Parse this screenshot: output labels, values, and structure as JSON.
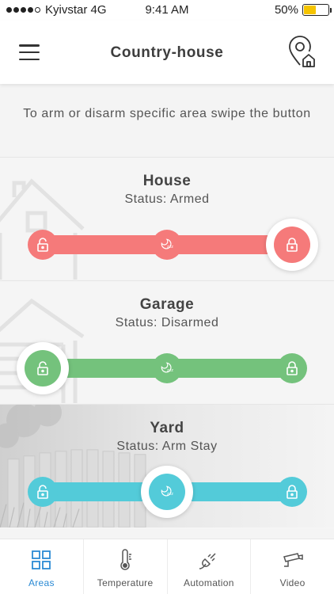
{
  "status_bar": {
    "carrier": "Kyivstar 4G",
    "time": "9:41 AM",
    "battery": "50%",
    "battery_level": 0.5
  },
  "header": {
    "title": "Country-house"
  },
  "instruction": "To arm or disarm specific area swipe the button",
  "areas": [
    {
      "name": "House",
      "status": "Status: Armed",
      "color": "#f57a7a",
      "state": "armed"
    },
    {
      "name": "Garage",
      "status": "Status: Disarmed",
      "color": "#74c27c",
      "state": "disarmed"
    },
    {
      "name": "Yard",
      "status": "Status: Arm Stay",
      "color": "#53cbd9",
      "state": "stay"
    }
  ],
  "tabs": [
    {
      "label": "Areas",
      "icon": "grid-icon",
      "active": true
    },
    {
      "label": "Temperature",
      "icon": "thermometer-icon",
      "active": false
    },
    {
      "label": "Automation",
      "icon": "plug-icon",
      "active": false
    },
    {
      "label": "Video",
      "icon": "camera-icon",
      "active": false
    }
  ],
  "colors": {
    "accent": "#2b8ad4",
    "armed": "#f57a7a",
    "disarmed": "#74c27c",
    "stay": "#53cbd9"
  }
}
